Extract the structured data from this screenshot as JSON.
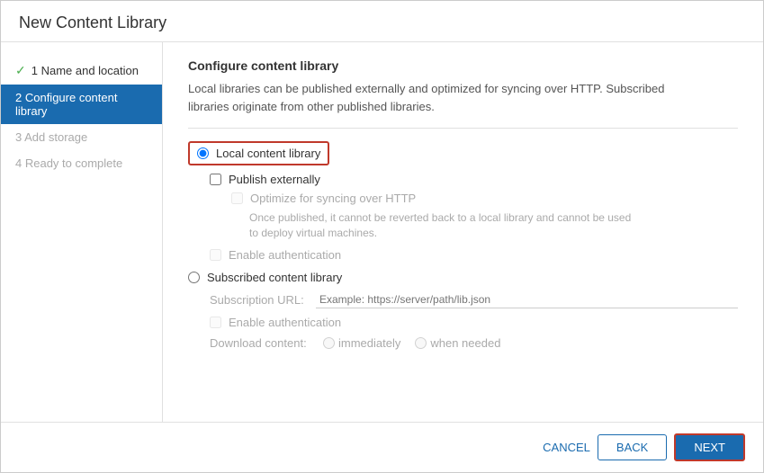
{
  "dialog": {
    "title": "New Content Library"
  },
  "sidebar": {
    "items": [
      {
        "id": "step1",
        "label": "1 Name and location",
        "state": "completed"
      },
      {
        "id": "step2",
        "label": "2 Configure content library",
        "state": "active"
      },
      {
        "id": "step3",
        "label": "3 Add storage",
        "state": "disabled"
      },
      {
        "id": "step4",
        "label": "4 Ready to complete",
        "state": "disabled"
      }
    ]
  },
  "main": {
    "section_title": "Configure content library",
    "description_line1": "Local libraries can be published externally and optimized for syncing over HTTP. Subscribed",
    "description_line2": "libraries originate from other published libraries.",
    "local_library_label": "Local content library",
    "publish_externally_label": "Publish externally",
    "optimize_label": "Optimize for syncing over HTTP",
    "optimize_note": "Once published, it cannot be reverted back to a local library and cannot be used\nto deploy virtual machines.",
    "enable_auth_local_label": "Enable authentication",
    "subscribed_label": "Subscribed content library",
    "subscription_url_label": "Subscription URL:",
    "subscription_url_placeholder": "Example: https://server/path/lib.json",
    "enable_auth_sub_label": "Enable authentication",
    "download_content_label": "Download content:",
    "immediately_label": "immediately",
    "when_needed_label": "when needed"
  },
  "footer": {
    "cancel_label": "CANCEL",
    "back_label": "BACK",
    "next_label": "NEXT"
  }
}
